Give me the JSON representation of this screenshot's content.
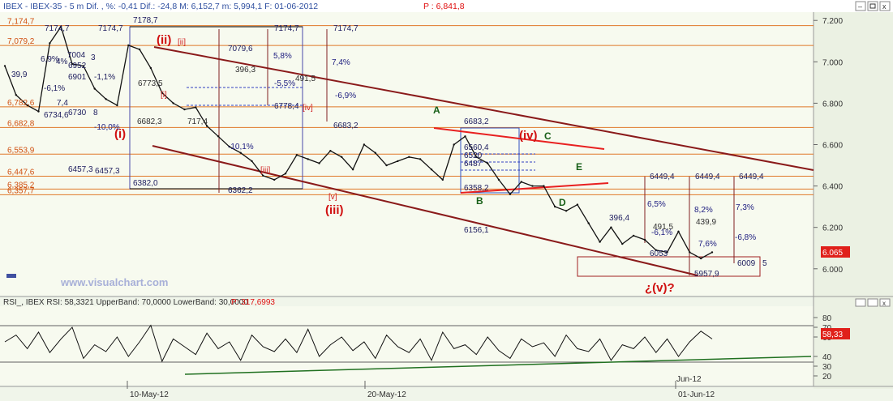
{
  "header": {
    "title": "IBEX - IBEX-35 -  5 m Dif. , %: -0,41 Dif.: -24,8 M: 6,152,7 m: 5,994,1 F: 01-06-2012",
    "p_label": "P : 6,841,8"
  },
  "watermark": "www.visualchart.com",
  "price_axis": {
    "ticks": [
      "7.200",
      "7.000",
      "6.800",
      "6.600",
      "6.400",
      "6.200",
      "6.000"
    ],
    "current_label": "6.065",
    "ylim": [
      5870,
      7240
    ]
  },
  "rsi_panel": {
    "header": "RSI_, IBEX RSI: 58,3321 UpperBand: 70,0000 LowerBand: 30,0000",
    "p_label": "P: 317,6993",
    "axis_ticks": [
      "80",
      "70",
      "60",
      "40",
      "30",
      "20"
    ],
    "current_label": "58,33",
    "ylim": [
      10,
      90
    ]
  },
  "date_axis": [
    "10-May-12",
    "20-May-12",
    "01-Jun-12"
  ],
  "jun_label": "Jun-12",
  "level_labels": [
    "7,174,7",
    "7,079,2",
    "6,782,6",
    "6,682,8",
    "6,553,9",
    "6,447,6",
    "6,385,2",
    "6,357,7"
  ],
  "box_labels": [
    "7178,7",
    "7174,7",
    "7174,7",
    "7174,7",
    "7174,7",
    "7079,6",
    "6382,0",
    "6362,2",
    "6457,3",
    "6457,3",
    "6778,4",
    "6683,2",
    "6683,2",
    "6560,4",
    "6520",
    "6487",
    "6358,2",
    "6156,1",
    "6449,4",
    "6449,4",
    "6449,4",
    "6009",
    "5",
    "5957,9",
    "6053",
    "396,4"
  ],
  "wave_labels": [
    "(i)",
    "(ii)",
    "(iii)",
    "(iv)",
    "¿(v)?",
    "A",
    "B",
    "C",
    "D",
    "E"
  ],
  "small_labels": [
    "[ii]",
    "[i]",
    "[iii]",
    "[iv]",
    "[v]"
  ],
  "percent_labels": [
    "5,8%",
    "-5,5%",
    "7,4%",
    "-6,9%",
    "-10,0%",
    "-10,1%",
    "6,5%",
    "-6,1%",
    "8,2%",
    "7,3%",
    "-6,8%",
    "7,6%",
    "396,3",
    "491,5",
    "491,5",
    "439,9",
    "717,4",
    "6682,3",
    "6773,5"
  ],
  "left_labels": [
    "-6,1%",
    "6,9%",
    "4%",
    "6952",
    "6901",
    "6730",
    "6734,6",
    "7,4",
    "3",
    "-1,1%",
    "39,9",
    "8",
    "7004"
  ],
  "chart_data": {
    "type": "line",
    "title": "IBEX - IBEX-35 - 5 m",
    "xlabel": "",
    "ylabel": "",
    "x": [
      "10-May-12",
      "20-May-12",
      "01-Jun-12"
    ],
    "series": [
      {
        "values": [
          6980,
          6840,
          6790,
          6760,
          7090,
          7170,
          6990,
          6980,
          6870,
          6820,
          6790,
          7080,
          7060,
          6970,
          6850,
          6800,
          6770,
          6780,
          6690,
          6640,
          6590,
          6560,
          6520,
          6450,
          6430,
          6460,
          6550,
          6530,
          6510,
          6570,
          6540,
          6480,
          6600,
          6560,
          6500,
          6520,
          6540,
          6530,
          6480,
          6430,
          6600,
          6640,
          6540,
          6510,
          6430,
          6360,
          6420,
          6400,
          6400,
          6300,
          6280,
          6310,
          6220,
          6130,
          6200,
          6120,
          6160,
          6140,
          6090,
          6080,
          6180,
          6080,
          6050,
          6080
        ]
      },
      {
        "name": "RSI",
        "values": [
          55,
          62,
          48,
          65,
          44,
          58,
          70,
          38,
          52,
          45,
          60,
          40,
          55,
          72,
          35,
          58,
          50,
          42,
          64,
          48,
          55,
          36,
          62,
          50,
          45,
          58,
          44,
          68,
          40,
          52,
          60,
          46,
          55,
          38,
          62,
          50,
          44,
          58,
          36,
          65,
          48,
          52,
          42,
          60,
          46,
          38,
          58,
          50,
          54,
          40,
          62,
          48,
          45,
          58,
          36,
          52,
          48,
          60,
          44,
          58,
          40,
          55,
          66,
          58
        ]
      }
    ],
    "rsi_bands": {
      "upper": 70,
      "lower": 30
    },
    "ylim": [
      5870,
      7240
    ],
    "grid": false
  }
}
